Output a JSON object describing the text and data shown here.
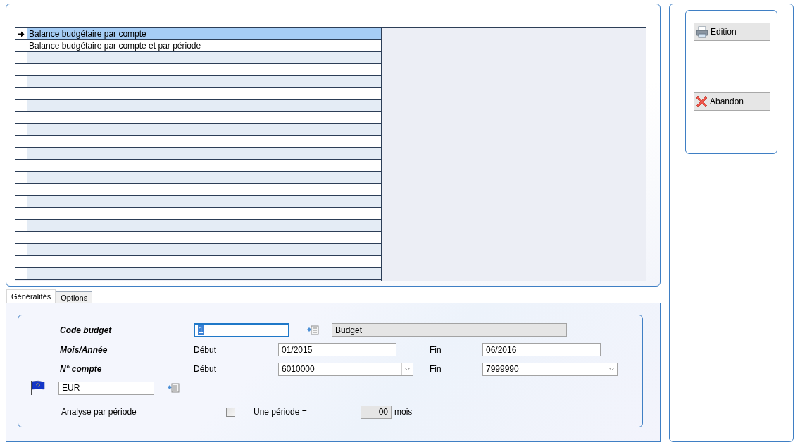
{
  "report_list": {
    "rows": [
      {
        "label": "Balance budgétaire par compte",
        "selected": true
      },
      {
        "label": "Balance budgétaire par compte et par période",
        "selected": false
      }
    ]
  },
  "tabs": [
    {
      "label": "Généralités",
      "selected": true
    },
    {
      "label": "Options",
      "selected": false
    }
  ],
  "form": {
    "code_budget": {
      "label": "Code budget",
      "value": "1",
      "description": "Budget"
    },
    "period": {
      "label": "Mois/Année",
      "start_label": "Début",
      "start": "01/2015",
      "end_label": "Fin",
      "end": "06/2016"
    },
    "account": {
      "label": "N° compte",
      "start_label": "Début",
      "start": "6010000",
      "end_label": "Fin",
      "end": "7999990"
    },
    "currency": {
      "value": "EUR"
    },
    "analysis": {
      "label": "Analyse par période",
      "checked": false,
      "period_label": "Une période =",
      "period_value": "00",
      "unit": "mois"
    }
  },
  "actions": [
    {
      "label": "Edition",
      "kind": "print"
    },
    {
      "label": "Abandon",
      "kind": "cancel"
    }
  ]
}
